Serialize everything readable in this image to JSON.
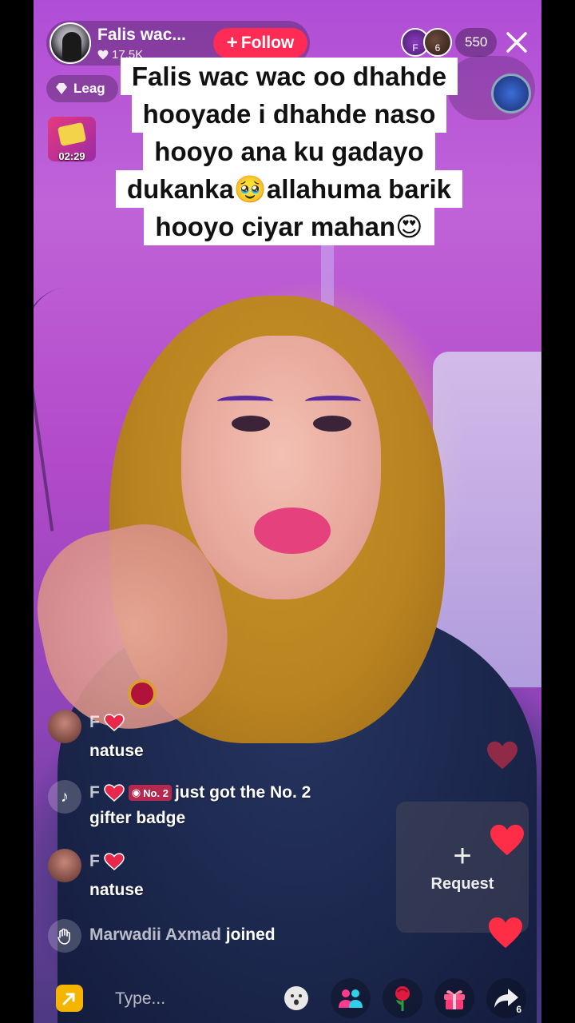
{
  "host": {
    "name": "Falis wac...",
    "likes": "17.5K",
    "follow_label": "Follow"
  },
  "viewers": {
    "avatar_a_badge": "F",
    "avatar_b_badge": "6",
    "count": "550"
  },
  "league": {
    "label": "Leag"
  },
  "timer": {
    "value": "02:29"
  },
  "caption": {
    "lines": [
      "Falis wac wac oo dhahde",
      "hooyade i dhahde naso",
      "hooyo ana ku gadayo",
      "dukanka🥹allahuma barik",
      "hooyo ciyar mahan😍"
    ]
  },
  "chat": [
    {
      "user": "F",
      "text": "natuse"
    },
    {
      "user": "F",
      "rank_badge": "No. 2",
      "text_line1": "just got the No. 2",
      "text_line2": "gifter badge"
    },
    {
      "user": "F",
      "text": "natuse"
    },
    {
      "user": "Marwadii Axmad",
      "text": "joined"
    }
  ],
  "request": {
    "label": "Request"
  },
  "bottom": {
    "type_placeholder": "Type...",
    "share_count": "6"
  },
  "colors": {
    "follow_red": "#fe2c55",
    "heart_red": "#ff2d45",
    "share_yellow": "#f5b400",
    "rank_badge": "#b5294e"
  }
}
